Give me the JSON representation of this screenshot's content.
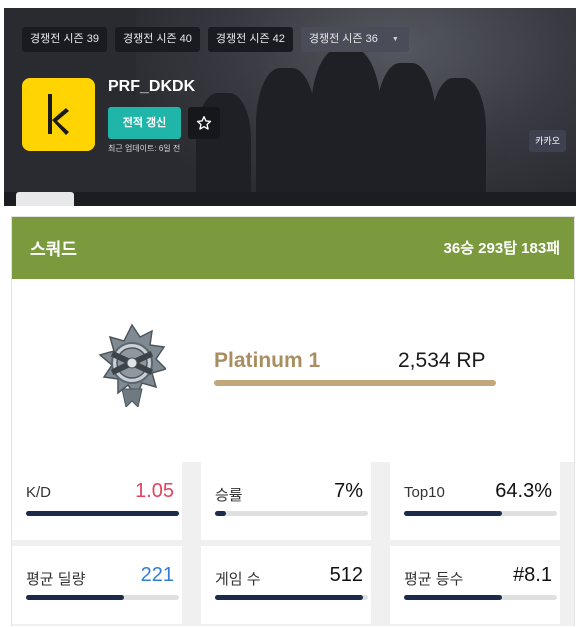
{
  "header": {
    "season_tabs": [
      {
        "label": "경쟁전 시즌 39"
      },
      {
        "label": "경쟁전 시즌 40"
      },
      {
        "label": "경쟁전 시즌 42"
      },
      {
        "label": "경쟁전 시즌 36",
        "selected": true
      }
    ],
    "player_name": "PRF_DKDK",
    "refresh_label": "전적 갱신",
    "favorite_icon": "star-icon",
    "updated_text": "최근 업데이트: 6일 전",
    "platform_badge": "카카오"
  },
  "squad": {
    "title": "스쿼드",
    "record": "36승 293탑 183패",
    "tier": "Platinum 1",
    "rp": "2,534 RP",
    "emblem_icon": "platinum-rank-emblem-icon",
    "stats": [
      {
        "label": "K/D",
        "value": "1.05",
        "color": "#e0455f",
        "fill": 1.0
      },
      {
        "label": "승률",
        "value": "7%",
        "color": "#111111",
        "fill": 0.07
      },
      {
        "label": "Top10",
        "value": "64.3%",
        "color": "#111111",
        "fill": 0.643
      },
      {
        "label": "평균 딜량",
        "value": "221",
        "color": "#2f7fd3",
        "fill": 0.64
      },
      {
        "label": "게임 수",
        "value": "512",
        "color": "#111111",
        "fill": 0.97
      },
      {
        "label": "평균 등수",
        "value": "#8.1",
        "color": "#111111",
        "fill": 0.64
      }
    ]
  },
  "colors": {
    "accent_teal": "#1fb5a8",
    "squad_header": "#7a9a3d",
    "tier_gold": "#c2a77b",
    "logo_yellow": "#ffd400"
  }
}
